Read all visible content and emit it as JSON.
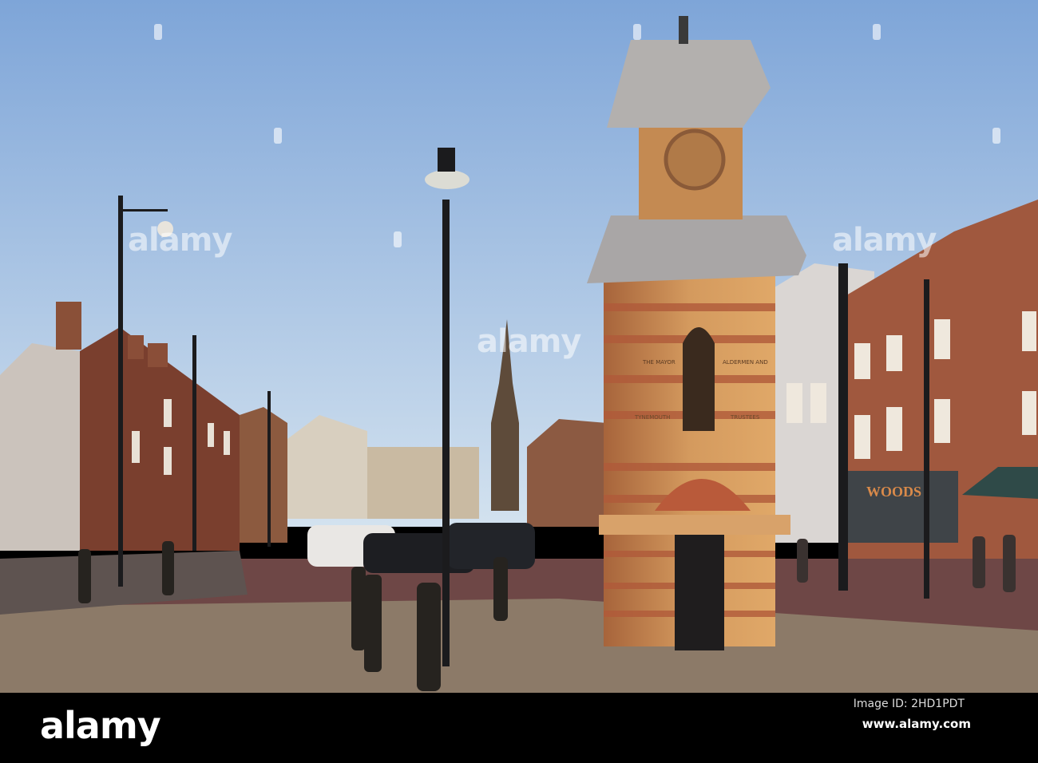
{
  "photo": {
    "tower_inscription": [
      "THE MAYOR",
      "ALDERMEN AND",
      "TYNEMOUTH",
      "TRUSTEES"
    ],
    "shop_sign": "WOODS",
    "colors": {
      "sky_top": "#7fa6d6",
      "sky_bottom": "#cfe0f0",
      "stone": "#c98a4e",
      "brick": "#b4583a",
      "pavement": "#8a7664",
      "road": "#7a4a48"
    }
  },
  "watermark": {
    "text": "alamy"
  },
  "footer": {
    "logo": "alamy",
    "image_id": "Image ID: 2HD1PDT",
    "url": "www.alamy.com"
  }
}
